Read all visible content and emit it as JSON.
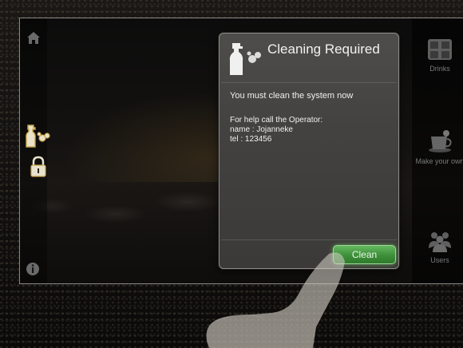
{
  "dialog": {
    "title": "Cleaning Required",
    "message": "You must clean the system now",
    "help_line": "For help call the Operator:",
    "name_line": "name : Jojanneke",
    "tel_line": "tel : 123456",
    "clean_button": "Clean",
    "icon": "cleaning-spray-icon"
  },
  "sidebar_right": {
    "items": [
      {
        "label": "Drinks",
        "icon": "drinks-grid-icon"
      },
      {
        "label": "Make your own",
        "icon": "cup-icon"
      },
      {
        "label": "Users",
        "icon": "users-icon"
      }
    ]
  },
  "sidebar_left": {
    "icons": [
      "home-icon",
      "cleaning-icon",
      "lock-icon",
      "info-icon"
    ]
  },
  "colors": {
    "button_green": "#4aa045",
    "dialog_bg": "#454442",
    "highlight_gold": "#d8c58a"
  }
}
